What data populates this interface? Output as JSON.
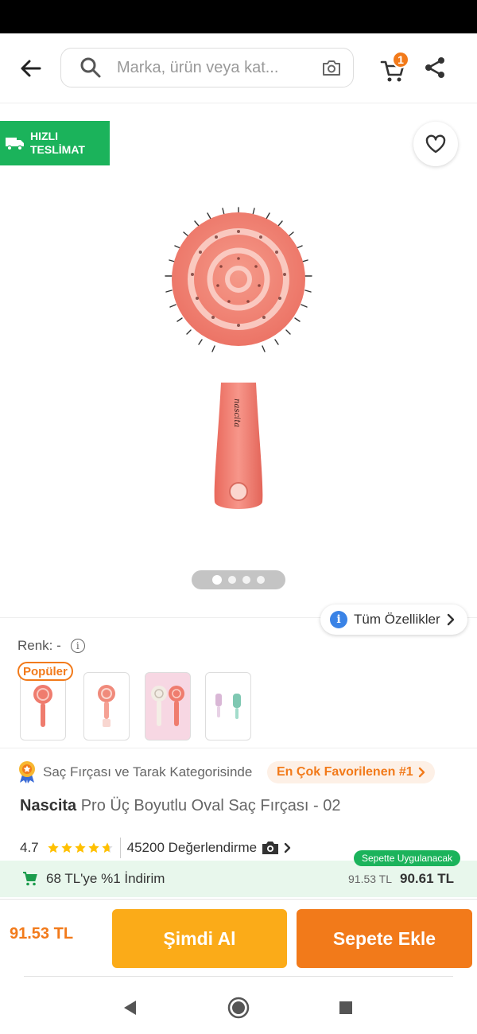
{
  "search": {
    "placeholder": "Marka, ürün veya kat..."
  },
  "header": {
    "cart_count": "1"
  },
  "product_image": {
    "fast_badge_line1": "HIZLI",
    "fast_badge_line2": "TESLİMAT",
    "pager": {
      "count": 4,
      "active": 1
    }
  },
  "features": {
    "all_features_label": "Tüm Özellikler"
  },
  "color": {
    "label": "Renk: -"
  },
  "variants": {
    "popular_label": "Popüler",
    "count": 4
  },
  "ranking": {
    "category_text": "Saç Fırçası ve Tarak Kategorisinde",
    "badge_text": "En Çok Favorilenen #1"
  },
  "product": {
    "brand": "Nascita",
    "name": "Pro Üç Boyutlu Oval Saç Fırçası - 02"
  },
  "rating": {
    "score": "4.7",
    "stars": 4.7,
    "reviews_label": "45200 Değerlendirme"
  },
  "discount": {
    "label": "68 TL'ye %1 İndirim",
    "applied_label": "Sepette Uygulanacak",
    "old_price": "91.53 TL",
    "new_price": "90.61 TL"
  },
  "bottom": {
    "price": "91.53 TL",
    "buy_now_label": "Şimdi Al",
    "add_to_cart_label": "Sepete Ekle"
  },
  "colors": {
    "brand_orange": "#f27a1a",
    "buy_now_yellow": "#fbab18",
    "green": "#1bb35b",
    "star_yellow": "#ffc000"
  }
}
